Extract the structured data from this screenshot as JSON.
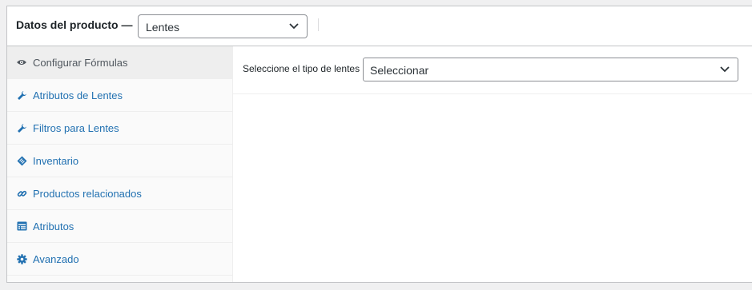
{
  "header": {
    "title": "Datos del producto —",
    "product_type": {
      "value": "Lentes",
      "icon": "chevron-down-icon"
    }
  },
  "tabs": [
    {
      "label": "Configurar Fórmulas",
      "icon": "eye-icon",
      "active": true
    },
    {
      "label": "Atributos de Lentes",
      "icon": "wrench-icon",
      "active": false
    },
    {
      "label": "Filtros para Lentes",
      "icon": "wrench-icon",
      "active": false
    },
    {
      "label": "Inventario",
      "icon": "tag-icon",
      "active": false
    },
    {
      "label": "Productos relacionados",
      "icon": "link-icon",
      "active": false
    },
    {
      "label": "Atributos",
      "icon": "table-icon",
      "active": false
    },
    {
      "label": "Avanzado",
      "icon": "gear-icon",
      "active": false
    }
  ],
  "options": {
    "lens_type_label": "Seleccione el tipo de lentes",
    "lens_type_value": "Seleccionar"
  },
  "colors": {
    "link": "#2271b1",
    "icon_blue": "#2271b1",
    "active_tab_bg": "#eeeeee",
    "border": "#c3c4c7"
  }
}
